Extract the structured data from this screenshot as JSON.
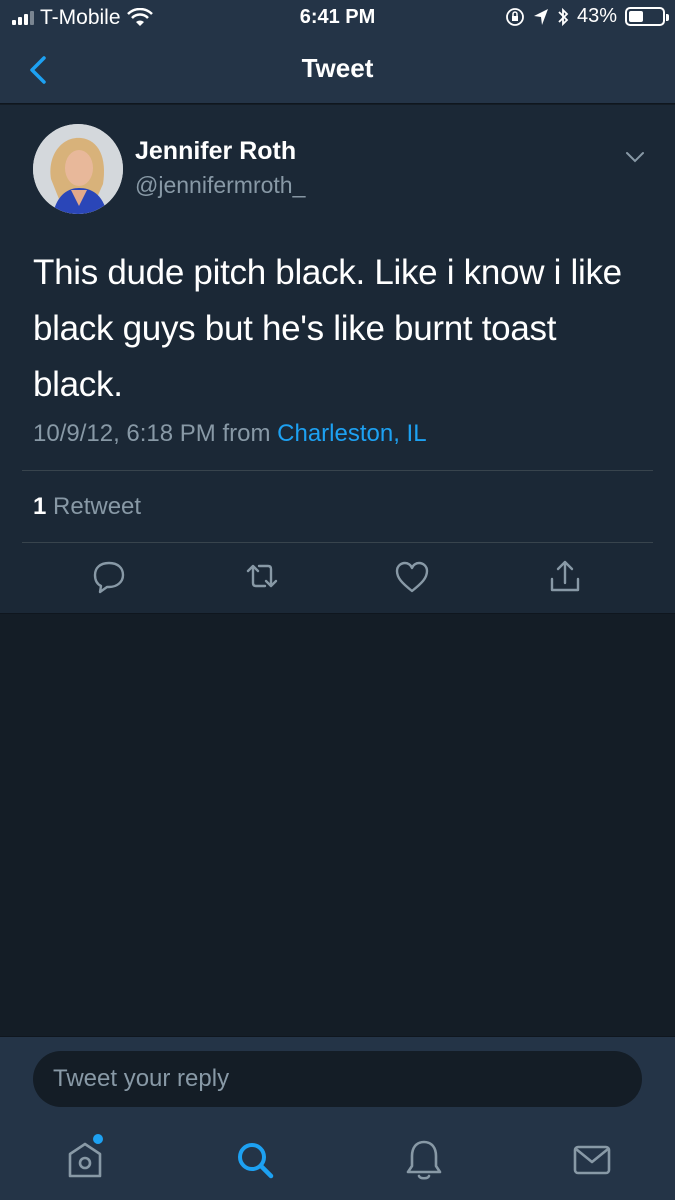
{
  "status_bar": {
    "carrier": "T-Mobile",
    "time": "6:41 PM",
    "battery_percent": "43%",
    "battery_level": 0.43
  },
  "nav": {
    "title": "Tweet"
  },
  "tweet": {
    "author_name": "Jennifer Roth",
    "author_handle": "@jennifermroth_",
    "text": "This dude pitch black. Like i know i like black guys but he's like burnt toast black.",
    "timestamp": "10/9/12, 6:18 PM from",
    "location": "Charleston, IL",
    "retweet_count": "1",
    "retweet_label": "Retweet"
  },
  "reply": {
    "placeholder": "Tweet your reply"
  },
  "colors": {
    "accent": "#1da1f2",
    "background": "#141d26",
    "card": "#1b2836",
    "bar": "#243447",
    "secondary_text": "#8899a6"
  }
}
